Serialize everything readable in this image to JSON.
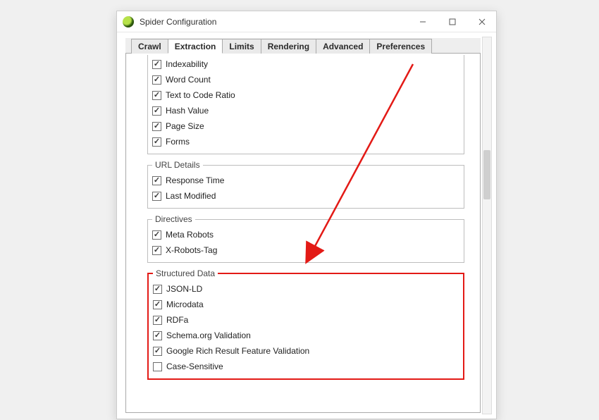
{
  "window": {
    "title": "Spider Configuration"
  },
  "tabs": [
    "Crawl",
    "Extraction",
    "Limits",
    "Rendering",
    "Advanced",
    "Preferences"
  ],
  "activeTabIndex": 1,
  "groups": {
    "top_items": [
      {
        "label": "Indexability",
        "checked": true
      },
      {
        "label": "Word Count",
        "checked": true
      },
      {
        "label": "Text to Code Ratio",
        "checked": true
      },
      {
        "label": "Hash Value",
        "checked": true
      },
      {
        "label": "Page Size",
        "checked": true
      },
      {
        "label": "Forms",
        "checked": true
      }
    ],
    "url_details": {
      "legend": "URL Details",
      "items": [
        {
          "label": "Response Time",
          "checked": true
        },
        {
          "label": "Last Modified",
          "checked": true
        }
      ]
    },
    "directives": {
      "legend": "Directives",
      "items": [
        {
          "label": "Meta Robots",
          "checked": true
        },
        {
          "label": "X-Robots-Tag",
          "checked": true
        }
      ]
    },
    "structured_data": {
      "legend": "Structured Data",
      "items": [
        {
          "label": "JSON-LD",
          "checked": true
        },
        {
          "label": "Microdata",
          "checked": true
        },
        {
          "label": "RDFa",
          "checked": true
        },
        {
          "label": "Schema.org Validation",
          "checked": true
        },
        {
          "label": "Google Rich Result Feature Validation",
          "checked": true
        },
        {
          "label": "Case-Sensitive",
          "checked": false
        }
      ]
    }
  }
}
